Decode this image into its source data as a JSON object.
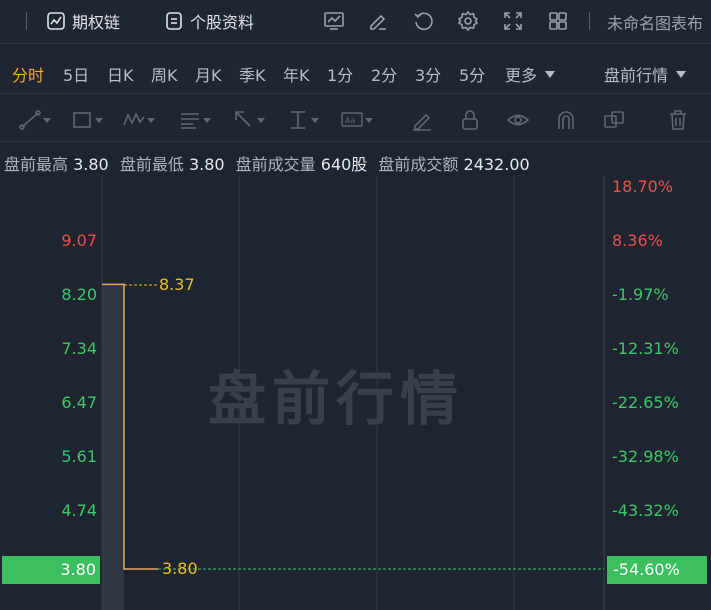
{
  "topbar": {
    "options_chain_label": "期权链",
    "stock_profile_label": "个股资料",
    "right_text": "未命名图表布"
  },
  "periods": [
    {
      "label": "分时",
      "active": true
    },
    {
      "label": "5日"
    },
    {
      "label": "日K"
    },
    {
      "label": "周K"
    },
    {
      "label": "月K"
    },
    {
      "label": "季K"
    },
    {
      "label": "年K"
    },
    {
      "label": "1分"
    },
    {
      "label": "2分"
    },
    {
      "label": "3分"
    },
    {
      "label": "5分"
    },
    {
      "label": "更多"
    }
  ],
  "session_select": "盘前行情",
  "info": {
    "high_label": "盘前最高",
    "high_value": "3.80",
    "low_label": "盘前最低",
    "low_value": "3.80",
    "volume_label": "盘前成交量",
    "volume_value": "640股",
    "amount_label": "盘前成交额",
    "amount_value": "2432.00"
  },
  "watermark": "盘前行情",
  "colors": {
    "up": "#e8504f",
    "down": "#3cc86b",
    "active": "#f3a73c",
    "price_line": "#e8a86a",
    "label": "#e8c020"
  },
  "chart_data": {
    "type": "line",
    "y_left_ticks": [
      "9.07",
      "8.20",
      "7.34",
      "6.47",
      "5.61",
      "4.74"
    ],
    "y_right_ticks": [
      "18.70%",
      "8.36%",
      "-1.97%",
      "-12.31%",
      "-22.65%",
      "-32.98%",
      "-43.32%"
    ],
    "current_price": "3.80",
    "current_pct": "-54.60%",
    "start_price": "8.37",
    "end_price": "3.80",
    "series": [
      {
        "values": [
          8.37,
          8.37,
          3.8,
          3.8
        ]
      }
    ]
  }
}
